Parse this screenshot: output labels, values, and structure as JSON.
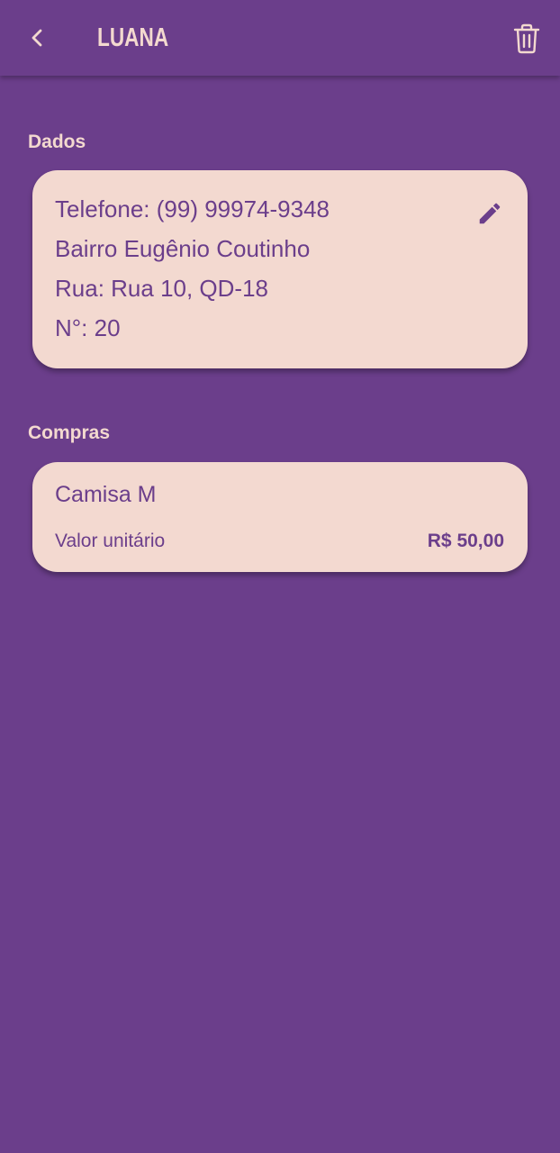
{
  "header": {
    "title": "LUANA",
    "back_icon": "chevron-left-icon",
    "delete_icon": "trash-icon"
  },
  "dados": {
    "section_title": "Dados",
    "telefone": "Telefone: (99) 99974-9348",
    "bairro": "Bairro Eugênio Coutinho",
    "rua": "Rua: Rua 10, QD-18",
    "numero": "N°: 20",
    "edit_icon": "pencil-icon"
  },
  "compras": {
    "section_title": "Compras",
    "items": [
      {
        "name": "Camisa M",
        "unit_label": "Valor unitário",
        "unit_value": "R$ 50,00"
      }
    ]
  },
  "colors": {
    "background": "#6b3e8b",
    "card": "#f3d9d0",
    "accent_text": "#f3d9cf"
  }
}
